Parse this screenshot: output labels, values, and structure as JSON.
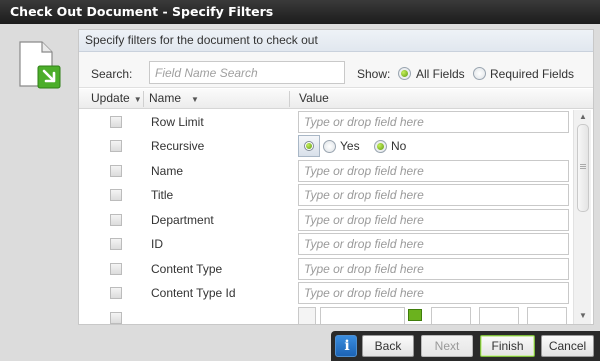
{
  "window": {
    "title": "Check Out Document - Specify Filters"
  },
  "panel": {
    "header": "Specify filters for the document to check out"
  },
  "search": {
    "label": "Search:",
    "placeholder": "Field Name Search"
  },
  "show": {
    "label": "Show:",
    "options": [
      {
        "label": "All Fields",
        "selected": true
      },
      {
        "label": "Required Fields",
        "selected": false
      }
    ]
  },
  "columns": {
    "update": "Update",
    "name": "Name",
    "value": "Value"
  },
  "value_placeholder": "Type or drop field here",
  "rows": [
    {
      "name": "Row Limit"
    },
    {
      "name": "Recursive",
      "yes_label": "Yes",
      "no_label": "No",
      "selected": "No"
    },
    {
      "name": "Name"
    },
    {
      "name": "Title"
    },
    {
      "name": "Department"
    },
    {
      "name": "ID"
    },
    {
      "name": "Content Type"
    },
    {
      "name": "Content Type Id"
    }
  ],
  "buttons": {
    "back": "Back",
    "next": "Next",
    "finish": "Finish",
    "cancel": "Cancel",
    "info": "i"
  },
  "colors": {
    "titlebar": "#1f1f1f",
    "accent_green": "#6bb21e",
    "info_blue": "#2b77c9"
  }
}
